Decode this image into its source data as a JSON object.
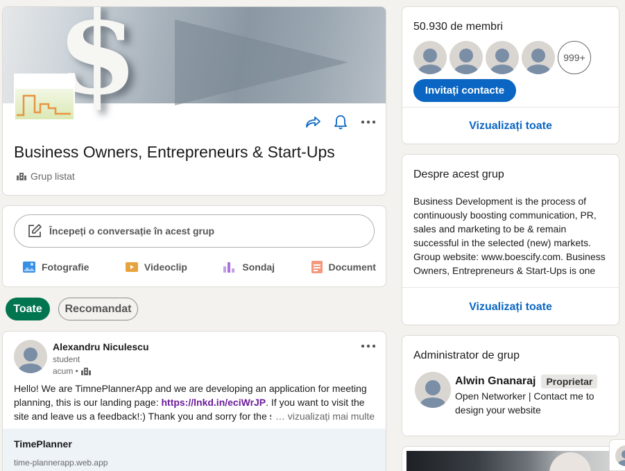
{
  "header": {
    "cover_symbol": "$",
    "title": "Business Owners, Entrepreneurs & Start-Ups",
    "group_type": "Grup listat"
  },
  "composer": {
    "start_label": "Începeți o conversație în acest grup",
    "photo": "Fotografie",
    "video": "Videoclip",
    "poll": "Sondaj",
    "document": "Document"
  },
  "filters": {
    "all": "Toate",
    "recommended": "Recomandat"
  },
  "post": {
    "author": "Alexandru Niculescu",
    "headline": "student",
    "time": "acum •",
    "text_before": "Hello! We are TimnePlannerApp and we are developing an application for meeting planning, this is our landing page: ",
    "link": "https://lnkd.in/eciWrJP",
    "text_after": ". If you want to visit the site and leave us a feedback!:) Thank you and sorry for the s",
    "see_more": "… vizualizați mai multe",
    "card_title": "TimePlanner",
    "card_url": "time-plannerapp.web.app"
  },
  "members": {
    "count": "50.930 de membri",
    "more": "999+",
    "invite": "Invitați contacte",
    "view_all": "Vizualizați toate"
  },
  "about": {
    "title": "Despre acest grup",
    "text": "Business Development is the process of continuously boosting communication, PR, sales and marketing to be & remain successful in the selected (new) markets. Group website: www.boescify.com. Business Owners, Entrepreneurs & Start-Ups is one o…",
    "view_all": "Vizualizați toate"
  },
  "admin": {
    "title": "Administrator de grup",
    "name": "Alwin Gnanaraj",
    "badge": "Proprietar",
    "headline": "Open Networker | Contact me to design your website"
  },
  "colors": {
    "primary": "#0a66c2",
    "active_filter": "#01754f",
    "page_bg": "#f4f2ee"
  }
}
